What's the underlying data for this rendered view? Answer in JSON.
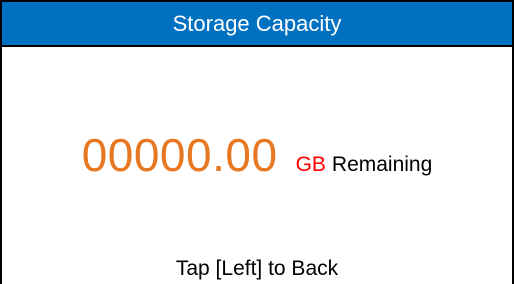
{
  "header": {
    "title": "Storage Capacity"
  },
  "capacity": {
    "value": "00000.00",
    "unit": "GB",
    "label": "Remaining"
  },
  "footer": {
    "hint": "Tap [Left] to Back"
  },
  "colors": {
    "title_bar": "#0070c0",
    "title_text": "#ffffff",
    "value": "#e87722",
    "unit": "#ff0000",
    "text": "#000000"
  }
}
